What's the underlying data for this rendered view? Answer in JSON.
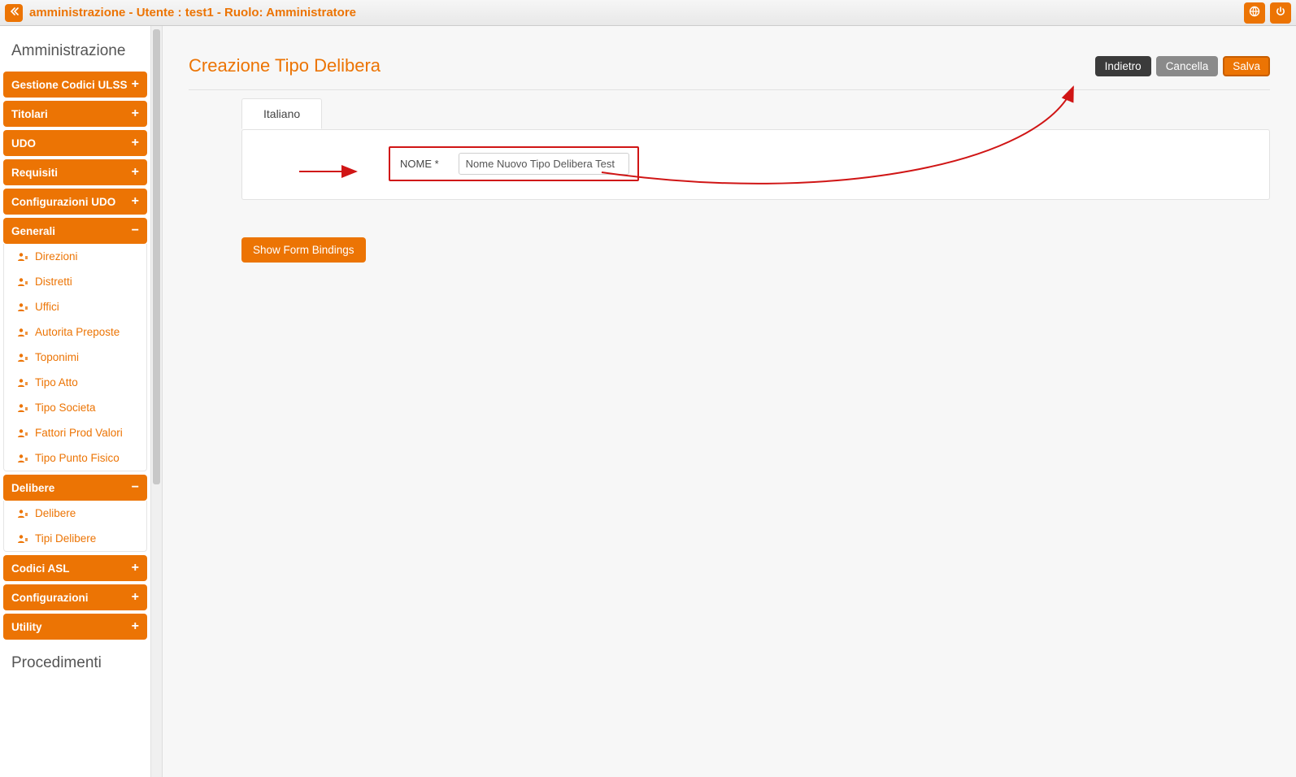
{
  "topbar": {
    "title": "amministrazione - Utente : test1 - Ruolo: Amministratore"
  },
  "sidebar": {
    "heading_main": "Amministrazione",
    "heading_secondary": "Procedimenti",
    "sections": [
      {
        "label": "Gestione Codici ULSS",
        "expanded": false
      },
      {
        "label": "Titolari",
        "expanded": false
      },
      {
        "label": "UDO",
        "expanded": false
      },
      {
        "label": "Requisiti",
        "expanded": false
      },
      {
        "label": "Configurazioni UDO",
        "expanded": false
      },
      {
        "label": "Generali",
        "expanded": true,
        "items": [
          "Direzioni",
          "Distretti",
          "Uffici",
          "Autorita Preposte",
          "Toponimi",
          "Tipo Atto",
          "Tipo Societa",
          "Fattori Prod Valori",
          "Tipo Punto Fisico"
        ]
      },
      {
        "label": "Delibere",
        "expanded": true,
        "items": [
          "Delibere",
          "Tipi Delibere"
        ]
      },
      {
        "label": "Codici ASL",
        "expanded": false
      },
      {
        "label": "Configurazioni",
        "expanded": false
      },
      {
        "label": "Utility",
        "expanded": false
      }
    ]
  },
  "page": {
    "title": "Creazione Tipo Delibera",
    "buttons": {
      "back": "Indietro",
      "cancel": "Cancella",
      "save": "Salva"
    },
    "tab_label": "Italiano",
    "field_label": "NOME *",
    "field_value": "Nome Nuovo Tipo Delibera Test",
    "show_bindings": "Show Form Bindings"
  },
  "colors": {
    "accent": "#ec7404",
    "annotation": "#d01515"
  }
}
